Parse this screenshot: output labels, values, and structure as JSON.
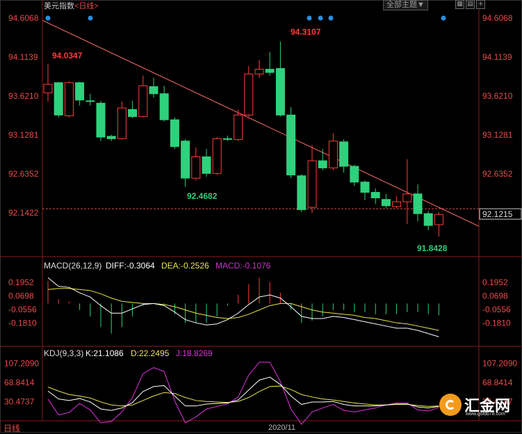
{
  "header": {
    "title": "美元指数",
    "period_tag": "<日线>",
    "theme_button": "全部主题▼"
  },
  "toolbar_icons": [
    "grid-icon",
    "book-icon",
    "plus-icon"
  ],
  "footer": {
    "period_label": "日线",
    "date_label": "2020/11"
  },
  "watermark": {
    "brand": "汇金网",
    "url": "www.gold678.com"
  },
  "colors": {
    "up": "#ff3b3b",
    "down": "#2fd17c",
    "trend": "#ff7070",
    "dif": "#ffffff",
    "dea": "#e8e84a",
    "macd": "#cc33cc",
    "k": "#ffffff",
    "d": "#e8e84a",
    "j": "#dd33dd"
  },
  "chart_data": [
    {
      "type": "candlestick",
      "title": "美元指数",
      "ylim": [
        91.62,
        94.75
      ],
      "yticks": [
        "94.6068",
        "94.1139",
        "93.6210",
        "93.1281",
        "92.6352",
        "92.1422"
      ],
      "current_price": "92.1215",
      "annotations": {
        "high": "94.3107",
        "left_high": "94.0347",
        "mid_low": "92.4682",
        "low": "91.8428"
      },
      "candles": [
        {
          "o": 93.66,
          "c": 93.77,
          "h": 94.03,
          "l": 93.55
        },
        {
          "o": 93.79,
          "c": 93.38,
          "h": 93.8,
          "l": 93.35
        },
        {
          "o": 93.37,
          "c": 93.79,
          "h": 93.81,
          "l": 93.35
        },
        {
          "o": 93.79,
          "c": 93.57,
          "h": 93.8,
          "l": 93.5
        },
        {
          "o": 93.56,
          "c": 93.56,
          "h": 93.65,
          "l": 93.5
        },
        {
          "o": 93.53,
          "c": 93.1,
          "h": 93.56,
          "l": 93.05
        },
        {
          "o": 93.11,
          "c": 93.08,
          "h": 93.13,
          "l": 93.05
        },
        {
          "o": 93.08,
          "c": 93.47,
          "h": 93.55,
          "l": 93.07
        },
        {
          "o": 93.45,
          "c": 93.36,
          "h": 93.56,
          "l": 93.34
        },
        {
          "o": 93.36,
          "c": 93.75,
          "h": 93.88,
          "l": 93.35
        },
        {
          "o": 93.74,
          "c": 93.65,
          "h": 93.85,
          "l": 93.6
        },
        {
          "o": 93.65,
          "c": 93.32,
          "h": 93.75,
          "l": 93.3
        },
        {
          "o": 93.32,
          "c": 92.98,
          "h": 93.35,
          "l": 92.95
        },
        {
          "o": 93.05,
          "c": 92.58,
          "h": 93.07,
          "l": 92.47
        },
        {
          "o": 92.58,
          "c": 92.85,
          "h": 92.97,
          "l": 92.55
        },
        {
          "o": 92.85,
          "c": 92.64,
          "h": 92.95,
          "l": 92.6
        },
        {
          "o": 92.64,
          "c": 93.08,
          "h": 93.1,
          "l": 92.62
        },
        {
          "o": 93.08,
          "c": 93.08,
          "h": 93.12,
          "l": 93.05
        },
        {
          "o": 93.07,
          "c": 93.38,
          "h": 93.45,
          "l": 93.05
        },
        {
          "o": 93.38,
          "c": 93.9,
          "h": 94.0,
          "l": 93.36
        },
        {
          "o": 93.9,
          "c": 93.96,
          "h": 94.08,
          "l": 93.85
        },
        {
          "o": 93.96,
          "c": 93.92,
          "h": 94.18,
          "l": 93.88
        },
        {
          "o": 93.97,
          "c": 93.38,
          "h": 94.31,
          "l": 93.36
        },
        {
          "o": 93.38,
          "c": 92.62,
          "h": 93.48,
          "l": 92.58
        },
        {
          "o": 92.61,
          "c": 92.18,
          "h": 92.63,
          "l": 92.15
        },
        {
          "o": 92.21,
          "c": 92.8,
          "h": 93.0,
          "l": 92.14
        },
        {
          "o": 92.8,
          "c": 92.71,
          "h": 92.95,
          "l": 92.68
        },
        {
          "o": 92.71,
          "c": 93.05,
          "h": 93.15,
          "l": 92.68
        },
        {
          "o": 93.04,
          "c": 92.73,
          "h": 93.07,
          "l": 92.65
        },
        {
          "o": 92.73,
          "c": 92.53,
          "h": 92.75,
          "l": 92.48
        },
        {
          "o": 92.53,
          "c": 92.4,
          "h": 92.55,
          "l": 92.3
        },
        {
          "o": 92.4,
          "c": 92.33,
          "h": 92.45,
          "l": 92.25
        },
        {
          "o": 92.31,
          "c": 92.23,
          "h": 92.38,
          "l": 92.2
        },
        {
          "o": 92.22,
          "c": 92.28,
          "h": 92.35,
          "l": 92.2
        },
        {
          "o": 92.28,
          "c": 92.38,
          "h": 92.82,
          "l": 92.0
        },
        {
          "o": 92.38,
          "c": 92.13,
          "h": 92.5,
          "l": 92.03
        },
        {
          "o": 92.13,
          "c": 91.98,
          "h": 92.16,
          "l": 91.92
        },
        {
          "o": 91.99,
          "c": 92.12,
          "h": 92.15,
          "l": 91.84
        }
      ]
    },
    {
      "type": "bar+line",
      "title": "MACD(26,12,9)",
      "labels": {
        "dif": "DIFF:-0.3064",
        "dea": "DEA:-0.2526",
        "macd": "MACD:-0.1076"
      },
      "ylim": [
        -0.36,
        0.3
      ],
      "yticks": [
        "0.1952",
        "0.0698",
        "-0.0556",
        "-0.1810"
      ],
      "dif": [
        0.24,
        0.16,
        0.15,
        0.1,
        0.06,
        -0.02,
        -0.09,
        -0.09,
        -0.05,
        -0.01,
        0.0,
        -0.02,
        -0.08,
        -0.15,
        -0.18,
        -0.2,
        -0.19,
        -0.15,
        -0.09,
        -0.01,
        0.06,
        0.08,
        0.05,
        -0.03,
        -0.12,
        -0.14,
        -0.14,
        -0.12,
        -0.13,
        -0.15,
        -0.17,
        -0.19,
        -0.21,
        -0.23,
        -0.23,
        -0.25,
        -0.28,
        -0.31
      ],
      "dea": [
        0.13,
        0.14,
        0.14,
        0.13,
        0.12,
        0.09,
        0.05,
        0.02,
        0.01,
        0.0,
        0.0,
        -0.01,
        -0.03,
        -0.06,
        -0.09,
        -0.11,
        -0.13,
        -0.14,
        -0.13,
        -0.1,
        -0.06,
        -0.02,
        0.0,
        0.0,
        -0.03,
        -0.06,
        -0.08,
        -0.09,
        -0.1,
        -0.11,
        -0.13,
        -0.14,
        -0.16,
        -0.18,
        -0.19,
        -0.21,
        -0.23,
        -0.25
      ],
      "macd": [
        0.21,
        0.04,
        0.02,
        -0.06,
        -0.12,
        -0.22,
        -0.28,
        -0.22,
        -0.12,
        -0.02,
        0.0,
        -0.02,
        -0.1,
        -0.18,
        -0.18,
        -0.18,
        -0.12,
        -0.02,
        0.08,
        0.18,
        0.24,
        0.2,
        0.1,
        -0.06,
        -0.18,
        -0.16,
        -0.12,
        -0.06,
        -0.06,
        -0.08,
        -0.08,
        -0.1,
        -0.1,
        -0.1,
        -0.08,
        -0.08,
        -0.1,
        -0.11
      ]
    },
    {
      "type": "line",
      "title": "KDJ(9,3,3)",
      "labels": {
        "k": "K:21.1086",
        "d": "D:22.2495",
        "j": "J:18.8269"
      },
      "ylim": [
        -5,
        118
      ],
      "yticks": [
        "107.2090",
        "68.8414",
        "30.4737"
      ],
      "k": [
        52,
        36,
        33,
        37,
        30,
        16,
        13,
        18,
        29,
        51,
        61,
        63,
        42,
        22,
        22,
        26,
        27,
        28,
        34,
        54,
        74,
        80,
        65,
        42,
        25,
        30,
        30,
        31,
        25,
        22,
        22,
        22,
        24,
        26,
        26,
        20,
        18,
        21
      ],
      "d": [
        60,
        52,
        45,
        42,
        38,
        30,
        24,
        22,
        24,
        33,
        42,
        49,
        47,
        39,
        33,
        31,
        30,
        29,
        31,
        39,
        51,
        61,
        62,
        55,
        45,
        40,
        36,
        34,
        31,
        28,
        26,
        24,
        24,
        25,
        25,
        23,
        21,
        22
      ],
      "j": [
        36,
        4,
        9,
        27,
        14,
        -12,
        -9,
        10,
        39,
        87,
        99,
        91,
        32,
        -12,
        0,
        16,
        21,
        26,
        40,
        84,
        110,
        110,
        71,
        16,
        -15,
        10,
        18,
        25,
        13,
        10,
        14,
        18,
        24,
        28,
        28,
        14,
        12,
        19
      ]
    }
  ]
}
